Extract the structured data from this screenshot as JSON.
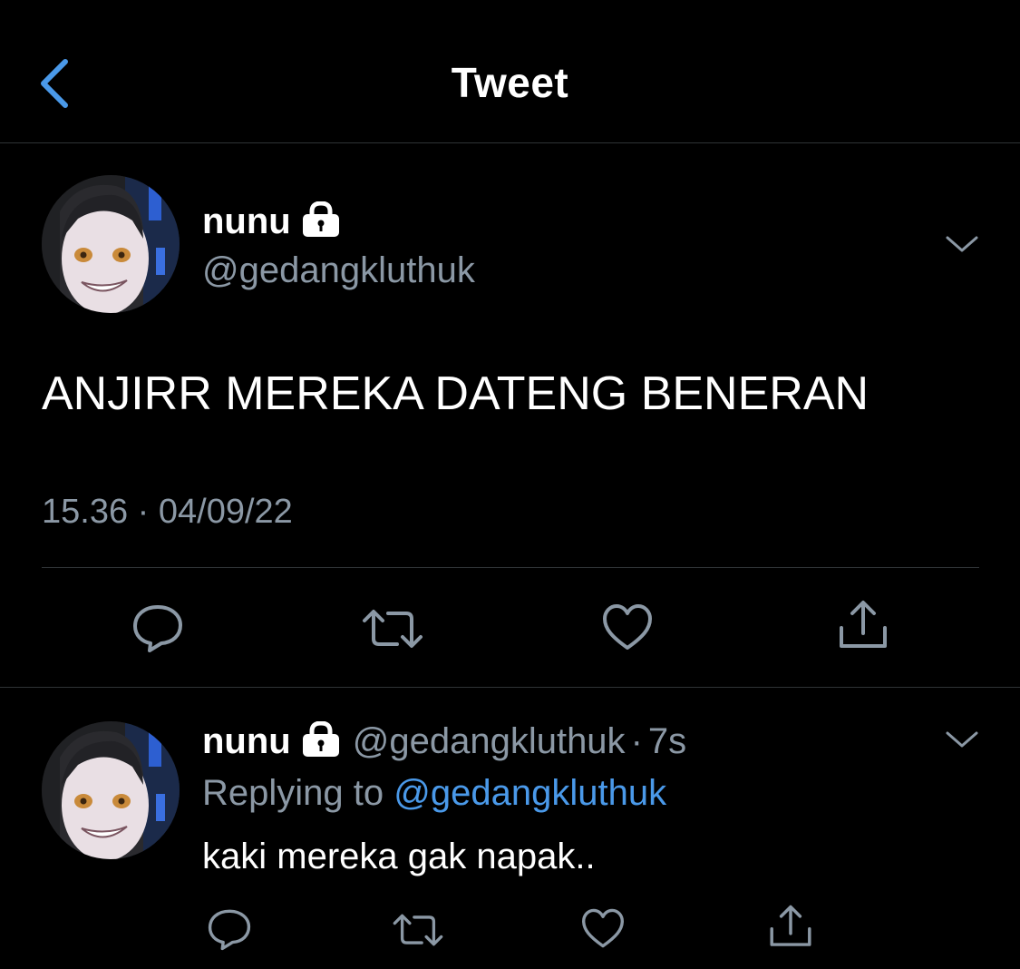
{
  "colors": {
    "background": "#000000",
    "accent": "#4a99e9",
    "secondary_text": "#8b98a5",
    "divider": "#2f3336"
  },
  "header": {
    "title": "Tweet",
    "back_icon": "chevron-left-icon"
  },
  "main_tweet": {
    "author": {
      "display_name": "nunu",
      "handle": "@gedangkluthuk",
      "protected_icon": "lock-icon"
    },
    "text": "ANJIRR MEREKA DATENG BENERAN",
    "time": "15.36",
    "separator": "·",
    "date": "04/09/22",
    "actions": [
      "reply-icon",
      "retweet-icon",
      "like-icon",
      "share-icon"
    ]
  },
  "reply_tweet": {
    "author": {
      "display_name": "nunu",
      "handle": "@gedangkluthuk",
      "protected_icon": "lock-icon"
    },
    "separator": "·",
    "time": "7s",
    "replying_prefix": "Replying to",
    "replying_to": "@gedangkluthuk",
    "text": "kaki mereka gak napak..",
    "actions": [
      "reply-icon",
      "retweet-icon",
      "like-icon",
      "share-icon"
    ]
  }
}
